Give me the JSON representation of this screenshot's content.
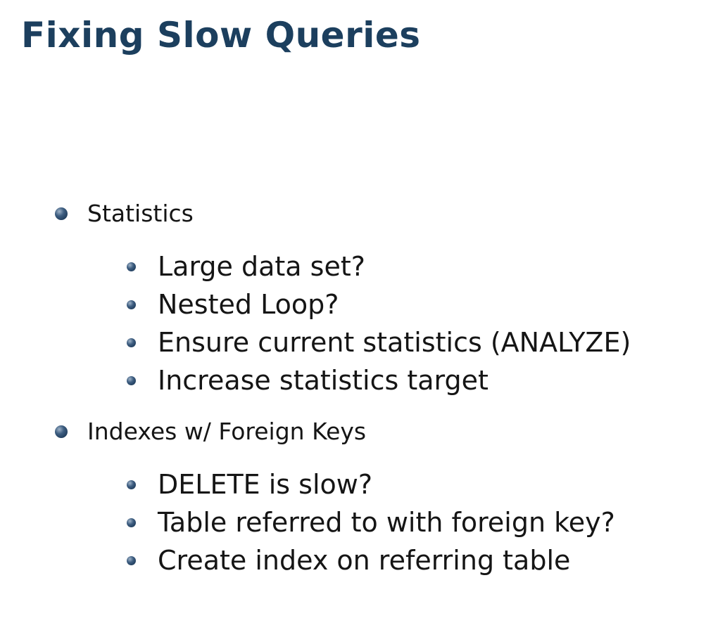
{
  "title": "Fixing Slow Queries",
  "sections": [
    {
      "label": "Statistics",
      "items": [
        "Large data set?",
        "Nested Loop?",
        "Ensure current statistics (ANALYZE)",
        "Increase statistics target"
      ]
    },
    {
      "label": "Indexes w/ Foreign Keys",
      "items": [
        "DELETE is slow?",
        "Table referred to with foreign key?",
        "Create index on referring table"
      ]
    }
  ],
  "colors": {
    "title": "#1c3f5e",
    "text": "#151515",
    "bullet": "#1f3f63"
  }
}
